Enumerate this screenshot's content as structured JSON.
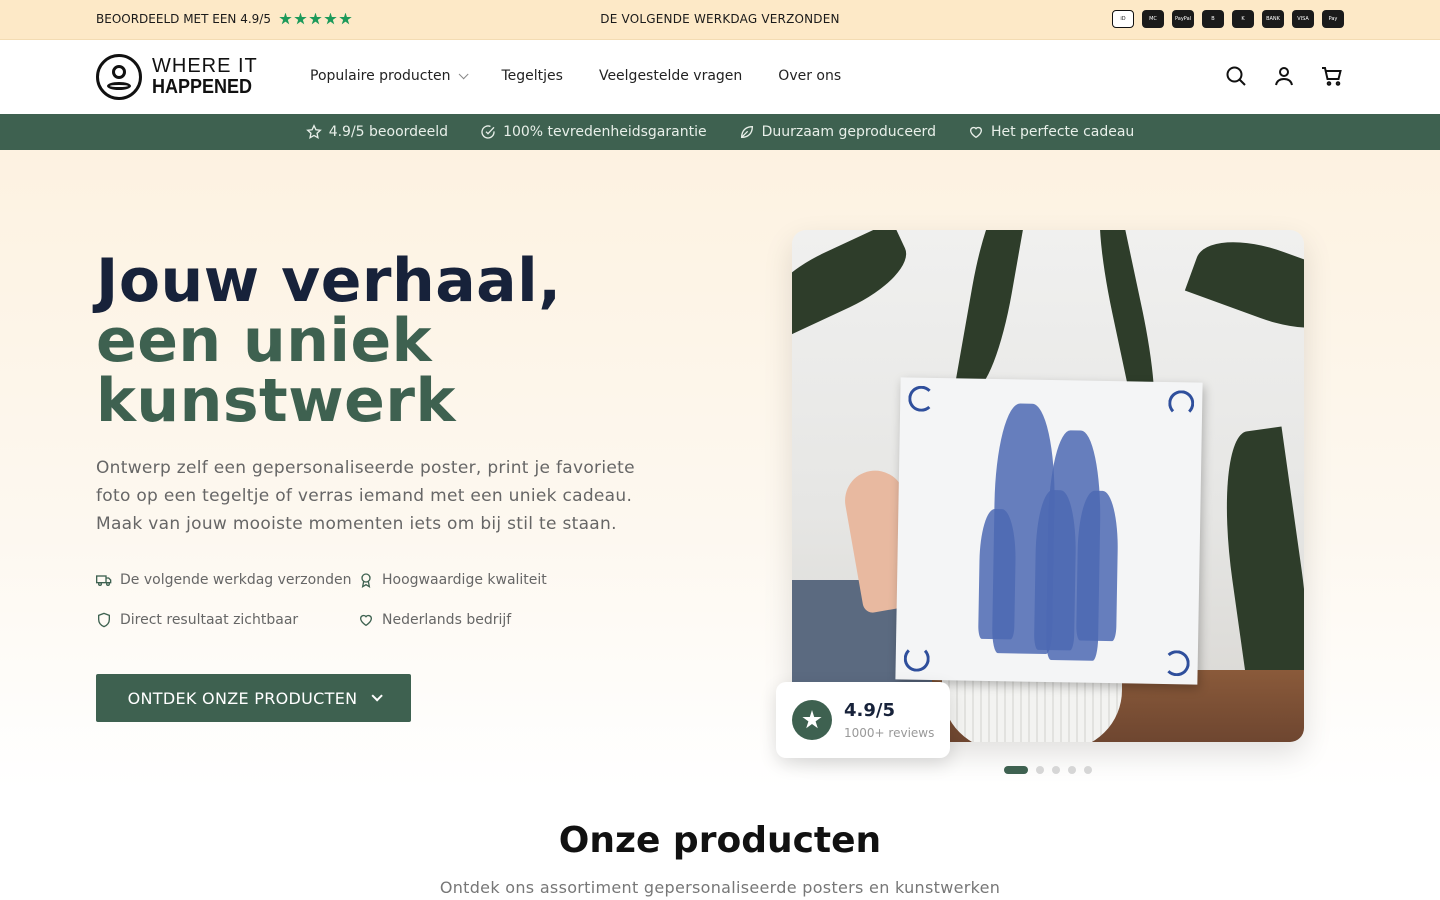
{
  "topbar": {
    "rating_text": "BEOORDEELD MET EEN 4.9/5",
    "shipping_text": "DE VOLGENDE WERKDAG VERZONDEN",
    "payment_icons": [
      "ideal-icon",
      "mastercard-icon",
      "paypal-icon",
      "bancontact-icon",
      "klarna-icon",
      "bank-icon",
      "visa-icon",
      "apple-pay-icon"
    ],
    "payment_labels": [
      "iD",
      "MC",
      "PayPal",
      "B",
      "K",
      "BANK",
      "VISA",
      "Pay"
    ]
  },
  "header": {
    "logo_line1": "WHERE IT",
    "logo_line2": "HAPPENED",
    "nav": [
      "Populaire producten",
      "Tegeltjes",
      "Veelgestelde vragen",
      "Over ons"
    ]
  },
  "trustbar": [
    "4.9/5 beoordeeld",
    "100% tevredenheidsgarantie",
    "Duurzaam geproduceerd",
    "Het perfecte cadeau"
  ],
  "hero": {
    "title_line1": "Jouw verhaal,",
    "title_line2": "een uniek kunstwerk",
    "lead": "Ontwerp zelf een gepersonaliseerde poster, print je favoriete foto op een tegeltje of verras iemand met een uniek cadeau. Maak van jouw mooiste momenten iets om bij stil te staan.",
    "features": [
      "De volgende werkdag verzonden",
      "Hoogwaardige kwaliteit",
      "Direct resultaat zichtbaar",
      "Nederlands bedrijf"
    ],
    "cta_label": "ONTDEK ONZE PRODUCTEN",
    "review_score": "4.9/5",
    "review_count": "1000+ reviews",
    "slides_total": 5,
    "slide_active": 1
  },
  "products": {
    "title": "Onze producten",
    "subtitle": "Ontdek ons assortiment gepersonaliseerde posters en kunstwerken"
  },
  "colors": {
    "accent_green": "#3e6150",
    "topbar_bg": "#fde9c7",
    "star_green": "#1c9a5a",
    "heading_navy": "#17223a"
  }
}
